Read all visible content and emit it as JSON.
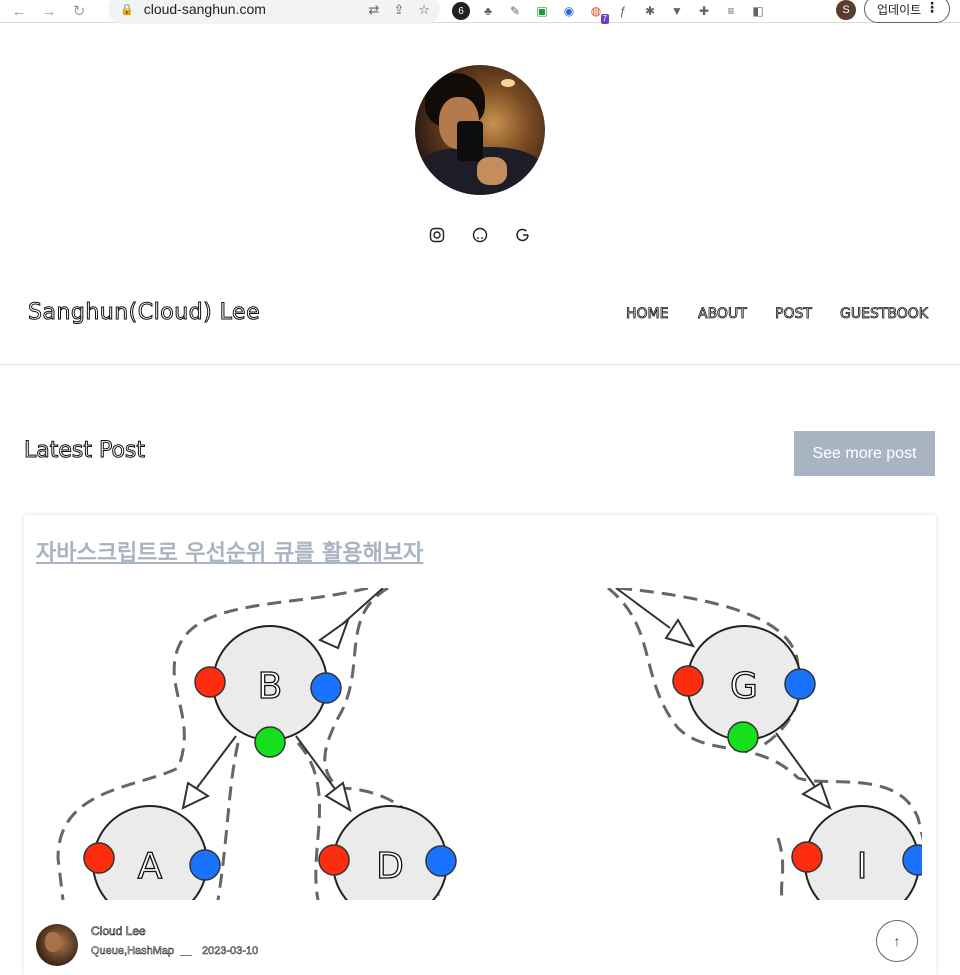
{
  "browser": {
    "back_icon": "arrow-left-icon",
    "forward_icon": "arrow-right-icon",
    "reload_icon": "reload-icon",
    "url": "cloud-sanghun.com",
    "profile_initial": "S",
    "update_label": "업데이트",
    "extension_badge": "7"
  },
  "profile": {
    "social_icons": [
      "instagram-icon",
      "github-icon",
      "google-icon"
    ],
    "social_glyphs": [
      "◎",
      "◌",
      "G"
    ]
  },
  "header": {
    "site_title": "Sanghun(Cloud) Lee",
    "nav": [
      "HOME",
      "ABOUT",
      "POST",
      "GUESTBOOK"
    ]
  },
  "latest": {
    "section_title": "Latest Post",
    "more_button": "See more post"
  },
  "post": {
    "title": "자바스크립트로 우선순위 큐를 활용해보자",
    "nodes": [
      "B",
      "G",
      "A",
      "D",
      "I"
    ],
    "author": "Cloud Lee",
    "tags": "Queue,HashMap",
    "date": "2023-03-10"
  },
  "colors": {
    "accent": "#a9b4c2",
    "node_red": "#ff2d10",
    "node_blue": "#1a73ff",
    "node_green": "#16e01e"
  }
}
